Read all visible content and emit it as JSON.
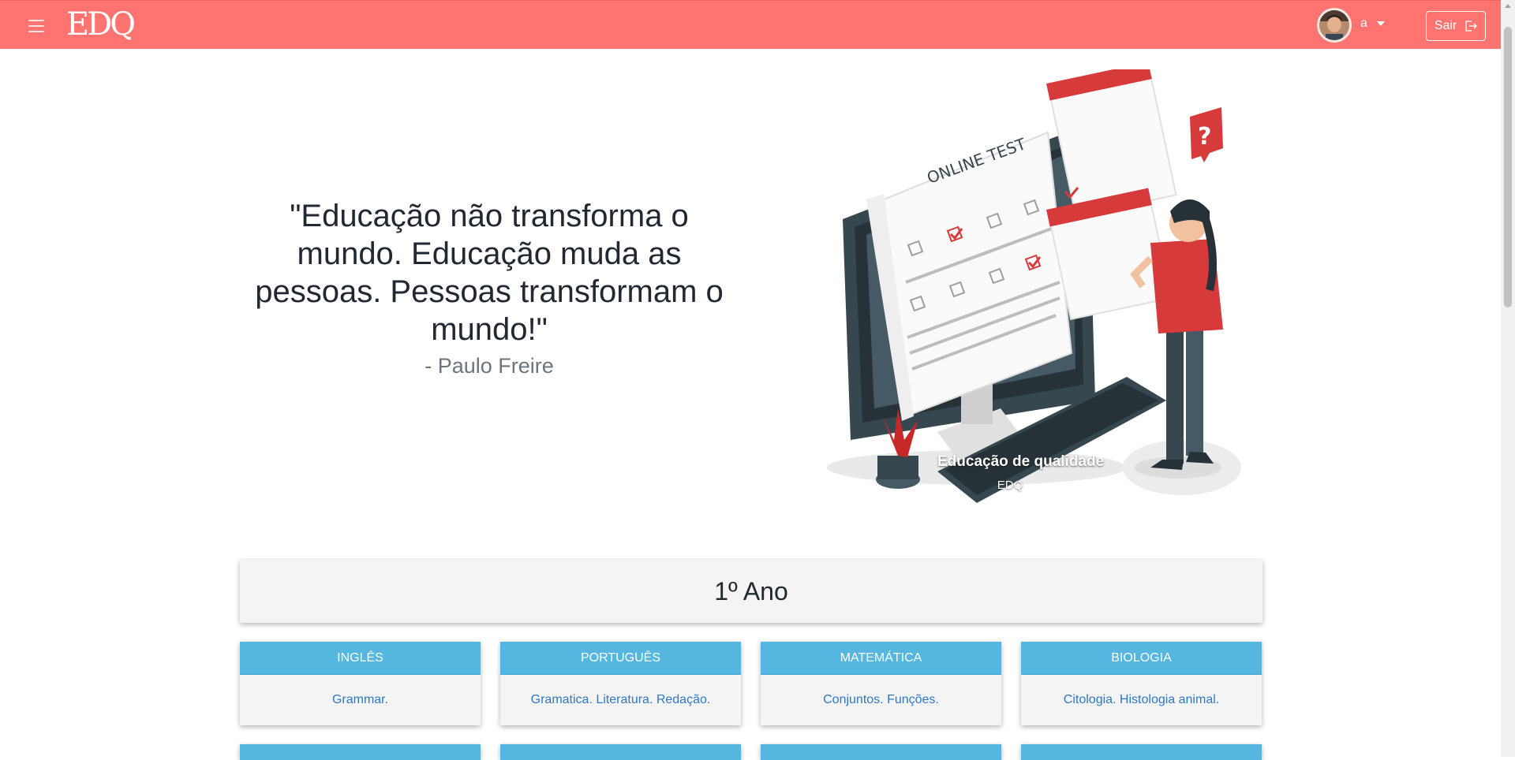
{
  "header": {
    "brand": "EDQ",
    "user_name": "a",
    "logout_label": "Sair",
    "bg_color": "#ff7370"
  },
  "hero": {
    "quote": "\"Educação não transforma o mundo. Educação muda as pessoas. Pessoas transformam o mundo!\"",
    "author": "- Paulo Freire",
    "slide_text": "ONLINE TEST",
    "caption_title": "Educação de qualidade",
    "caption_sub": "EDQ"
  },
  "section": {
    "title": "1º Ano"
  },
  "subjects": [
    {
      "name": "INGLÊS",
      "topics": "Grammar."
    },
    {
      "name": "PORTUGUÊS",
      "topics": "Gramatica. Literatura. Redação."
    },
    {
      "name": "MATEMÁTICA",
      "topics": "Conjuntos. Funções."
    },
    {
      "name": "BIOLOGIA",
      "topics": "Citologia. Histologia animal."
    }
  ],
  "colors": {
    "card_header": "#55b6df",
    "topic_link": "#2e78c5",
    "accent_red": "#d63a3a"
  }
}
